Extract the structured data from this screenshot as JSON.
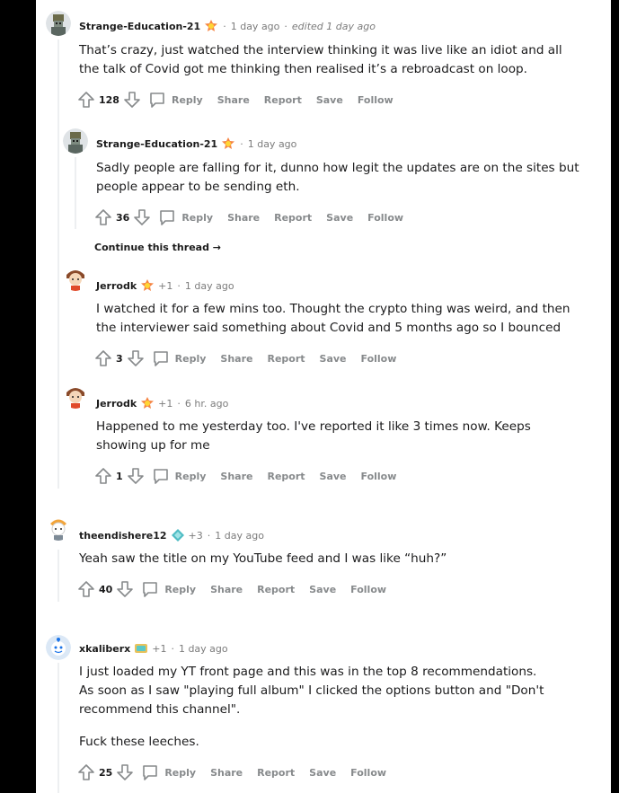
{
  "comments": [
    {
      "username": "Strange-Education-21",
      "flair": "award-icon",
      "karma": "",
      "time": "1 day ago",
      "edited": "edited 1 day ago",
      "paragraphs": [
        "That’s crazy, just watched the interview thinking it was live like an idiot and all the talk of Covid got me thinking then realised it’s a rebroadcast on loop."
      ],
      "score": "128"
    },
    {
      "username": "Strange-Education-21",
      "flair": "award-icon",
      "karma": "",
      "time": "1 day ago",
      "edited": "",
      "paragraphs": [
        "Sadly people are falling for it, dunno how legit the updates are on the sites but people appear to be sending eth."
      ],
      "score": "36"
    },
    {
      "username": "Jerrodk",
      "flair": "award-icon",
      "karma": "+1",
      "time": "1 day ago",
      "edited": "",
      "paragraphs": [
        "I watched it for a few mins too. Thought the crypto thing was weird, and then the interviewer said something about Covid and 5 months ago so I bounced"
      ],
      "score": "3"
    },
    {
      "username": "Jerrodk",
      "flair": "award-icon",
      "karma": "+1",
      "time": "6 hr. ago",
      "edited": "",
      "paragraphs": [
        "Happened to me yesterday too. I've reported it like 3 times now. Keeps showing up for me"
      ],
      "score": "1"
    },
    {
      "username": "theendishere12",
      "flair": "diamond-icon",
      "karma": "+3",
      "time": "1 day ago",
      "edited": "",
      "paragraphs": [
        "Yeah saw the title on my YouTube feed and I was like “huh?”"
      ],
      "score": "40"
    },
    {
      "username": "xkaliberx",
      "flair": "trophy-icon",
      "karma": "+1",
      "time": "1 day ago",
      "edited": "",
      "paragraphs": [
        "I just loaded my YT front page and this was in the top 8 recommendations. As soon as I saw \"playing full album\" I clicked the options button and \"Don't recommend this channel\".",
        "Fuck these leeches."
      ],
      "score": "25"
    }
  ],
  "actions": {
    "reply": "Reply",
    "share": "Share",
    "report": "Report",
    "save": "Save",
    "follow": "Follow"
  },
  "continue_thread": "Continue this thread",
  "colors": {
    "upvote": "#878a8c",
    "text": "#1a1a1b",
    "meta": "#7c7c7c",
    "thread_line": "#edeff1"
  }
}
